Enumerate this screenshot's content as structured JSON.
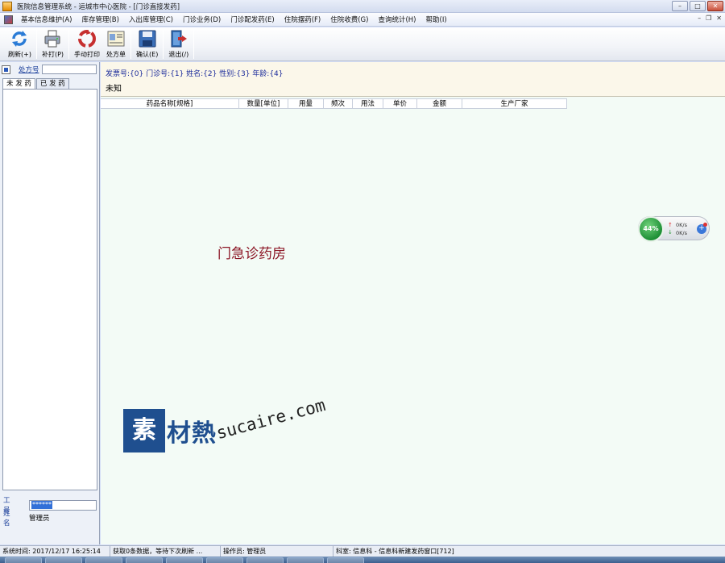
{
  "window": {
    "title": "医院信息管理系统    -    运城市中心医院 - [门诊直接发药]",
    "controls": {
      "minimize": "–",
      "restore": "□",
      "close": "✕"
    }
  },
  "menu": {
    "items": [
      "基本信息维护(A)",
      "库存管理(B)",
      "入出库管理(C)",
      "门诊业务(D)",
      "门诊配发药(E)",
      "住院摆药(F)",
      "住院收费(G)",
      "查询统计(H)",
      "帮助(I)"
    ],
    "mdi_controls": {
      "minimize": "–",
      "restore": "❐",
      "close": "✕"
    }
  },
  "toolbar": {
    "refresh": {
      "label": "刷新(+)",
      "icon": "refresh-icon"
    },
    "reprint": {
      "label": "补打(P)",
      "icon": "printer-icon"
    },
    "manual_print": {
      "label": "手动打印",
      "icon": "manual-print-icon"
    },
    "prescription": {
      "label": "处方单",
      "icon": "prescription-icon"
    },
    "confirm": {
      "label": "确认(E)",
      "icon": "save-disk-icon"
    },
    "exit": {
      "label": "退出(/)",
      "icon": "exit-door-icon"
    }
  },
  "left": {
    "rx_label": "处方号",
    "tabs": [
      "未 发 药",
      "已 发 药"
    ],
    "employee_no_label": "工 号",
    "employee_no_value": "******",
    "name_label": "姓 名",
    "name_value": "管理员"
  },
  "info": {
    "line": "发票号:{0} 门诊号:{1} 姓名:{2} 性别:{3} 年龄:{4}",
    "unknown": "未知"
  },
  "grid": {
    "columns": [
      "药品名称[规格]",
      "数量[单位]",
      "用量",
      "频次",
      "用法",
      "单价",
      "金额",
      "生产厂家"
    ]
  },
  "main_title": "门急诊药房",
  "net_widget": {
    "percent": "44%",
    "upload": "0K/s",
    "download": "0K/s",
    "up_arrow": "↑",
    "down_arrow": "↓",
    "plus": "+"
  },
  "watermark": {
    "brand_first": "素",
    "brand_rest": "材熱",
    "url": "sucaire.com"
  },
  "status": {
    "time": "系统时间: 2017/12/17 16:25:14",
    "message": "获取0条数据，等待下次刷新 ...",
    "operator": "操作员: 管理员",
    "department": "科室: 信息科 - 信息科新建发药窗口[712]"
  }
}
